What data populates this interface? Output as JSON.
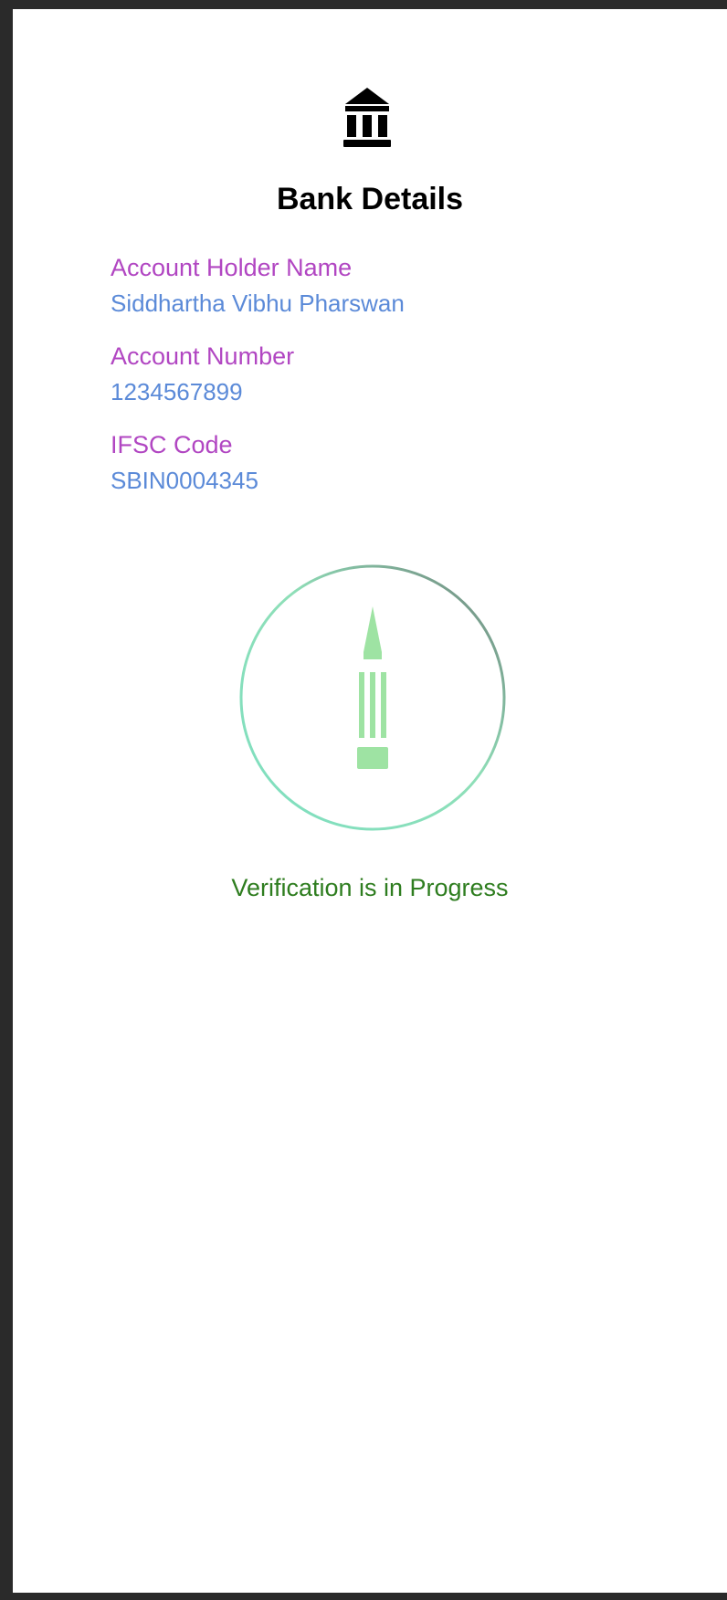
{
  "header": {
    "icon": "bank-icon",
    "title": "Bank Details"
  },
  "details": {
    "fields": [
      {
        "label": "Account Holder Name",
        "value": "Siddhartha Vibhu Pharswan"
      },
      {
        "label": "Account Number",
        "value": "1234567899"
      },
      {
        "label": "IFSC Code",
        "value": "SBIN0004345"
      }
    ]
  },
  "verification": {
    "icon": "pencil-icon",
    "status": "Verification is in Progress"
  },
  "colors": {
    "label": "#b146c2",
    "value": "#5b8ad8",
    "status": "#2e7d1f",
    "accent": "#8fe0a0"
  }
}
